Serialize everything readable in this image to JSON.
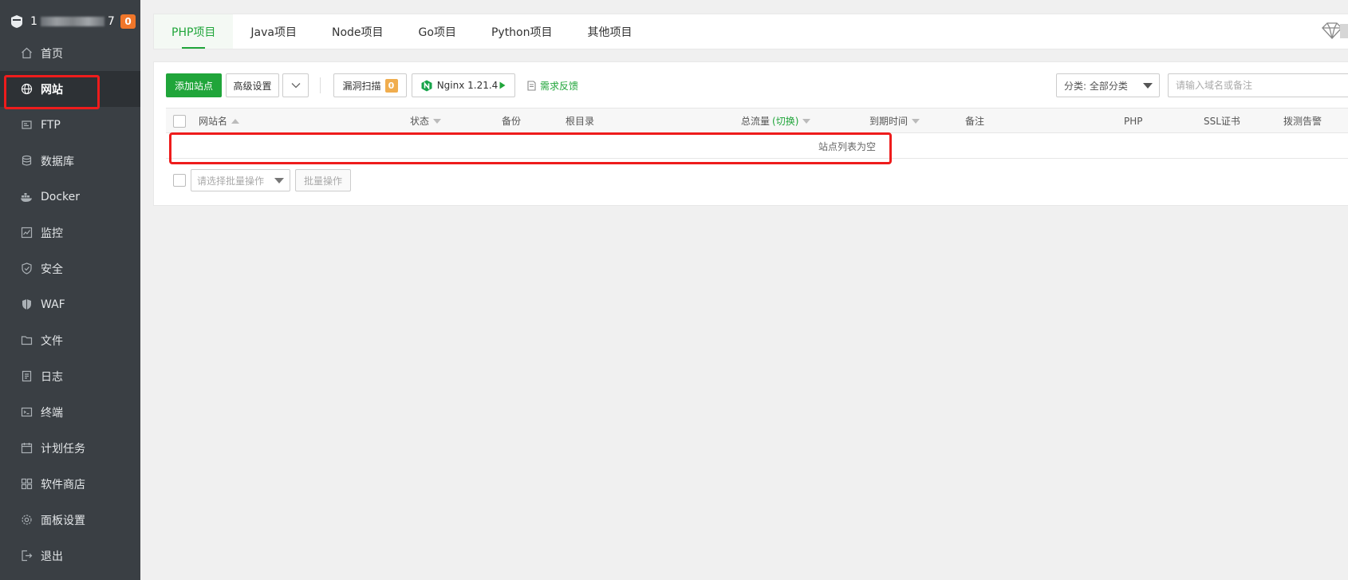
{
  "sidebar": {
    "host_prefix": "1",
    "host_suffix": "7",
    "badge": "0",
    "items": [
      {
        "label": "首页",
        "icon": "home-icon"
      },
      {
        "label": "网站",
        "icon": "globe-icon",
        "active": true
      },
      {
        "label": "FTP",
        "icon": "ftp-icon"
      },
      {
        "label": "数据库",
        "icon": "database-icon"
      },
      {
        "label": "Docker",
        "icon": "docker-icon"
      },
      {
        "label": "监控",
        "icon": "monitor-icon"
      },
      {
        "label": "安全",
        "icon": "shield-icon"
      },
      {
        "label": "WAF",
        "icon": "waf-shield-icon"
      },
      {
        "label": "文件",
        "icon": "folder-icon"
      },
      {
        "label": "日志",
        "icon": "log-icon"
      },
      {
        "label": "终端",
        "icon": "terminal-icon"
      },
      {
        "label": "计划任务",
        "icon": "calendar-icon"
      },
      {
        "label": "软件商店",
        "icon": "apps-icon"
      },
      {
        "label": "面板设置",
        "icon": "gear-icon"
      },
      {
        "label": "退出",
        "icon": "logout-icon"
      }
    ]
  },
  "tabs": [
    {
      "label": "PHP项目",
      "active": true
    },
    {
      "label": "Java项目"
    },
    {
      "label": "Node项目"
    },
    {
      "label": "Go项目"
    },
    {
      "label": "Python项目"
    },
    {
      "label": "其他项目"
    }
  ],
  "toolbar": {
    "add_site": "添加站点",
    "advanced": "高级设置",
    "vuln_scan": "漏洞扫描",
    "vuln_count": "0",
    "nginx": "Nginx 1.21.4",
    "feedback": "需求反馈",
    "category": "分类: 全部分类",
    "search_placeholder": "请输入域名或备注"
  },
  "table": {
    "headers": {
      "name": "网站名",
      "status": "状态",
      "backup": "备份",
      "root": "根目录",
      "traffic": "总流量",
      "traffic_switch": "(切换)",
      "expire": "到期时间",
      "remark": "备注",
      "php": "PHP",
      "ssl": "SSL证书",
      "alarm": "拨测告警"
    },
    "empty_text": "站点列表为空",
    "batch_placeholder": "请选择批量操作",
    "batch_button": "批量操作"
  },
  "colors": {
    "accent": "#20a53a",
    "sidebar_bg": "#3a3f44",
    "badge": "#f0762a",
    "highlight": "#ee1c1c"
  }
}
